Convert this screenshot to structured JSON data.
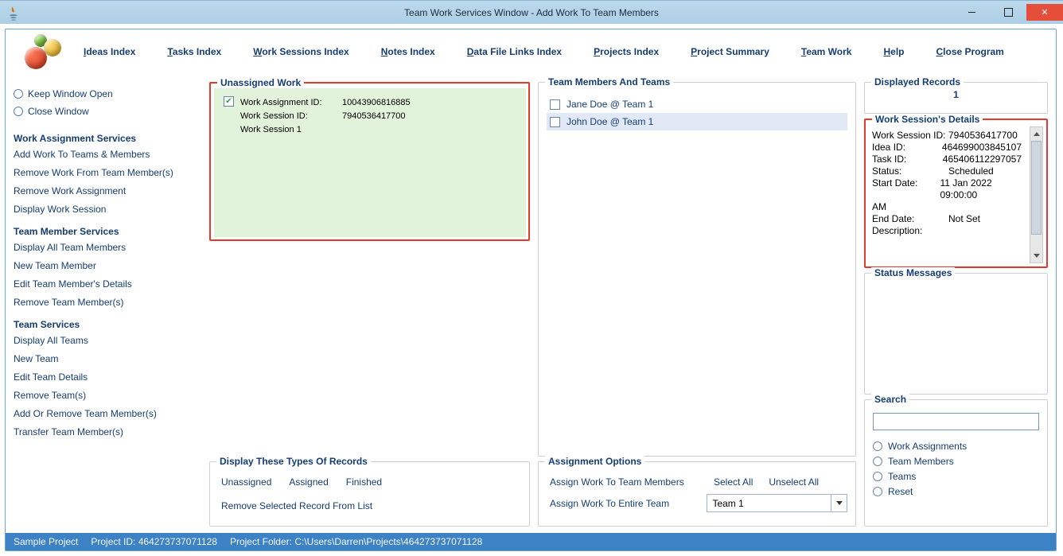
{
  "titlebar": {
    "title": "Team Work Services Window - Add Work To Team Members"
  },
  "menu": {
    "items": [
      {
        "label": "Ideas Index",
        "u": "I"
      },
      {
        "label": "Tasks Index",
        "u": "T"
      },
      {
        "label": "Work Sessions Index",
        "u": "W"
      },
      {
        "label": "Notes Index",
        "u": "N"
      },
      {
        "label": "Data File Links Index",
        "u": "D"
      },
      {
        "label": "Projects Index",
        "u": "P"
      },
      {
        "label": "Project Summary",
        "u": "P"
      },
      {
        "label": "Team Work",
        "u": "T"
      },
      {
        "label": "Help",
        "u": "H"
      },
      {
        "label": "Close Program",
        "u": "C"
      }
    ]
  },
  "sidebar": {
    "radios": {
      "keep": "Keep Window Open",
      "close": "Close Window"
    },
    "groups": [
      {
        "title": "Work Assignment Services",
        "links": [
          "Add Work To Teams & Members",
          "Remove Work From Team Member(s)",
          "Remove Work Assignment",
          "Display Work Session"
        ]
      },
      {
        "title": "Team Member Services",
        "links": [
          "Display All Team Members",
          "New Team Member",
          "Edit Team Member's Details",
          "Remove Team Member(s)"
        ]
      },
      {
        "title": "Team Services",
        "links": [
          "Display All Teams",
          "New Team",
          "Edit Team Details",
          "Remove Team(s)",
          "Add Or Remove Team Member(s)",
          "Transfer Team Member(s)"
        ]
      }
    ]
  },
  "unassigned": {
    "title": "Unassigned Work",
    "checked": true,
    "rows": [
      {
        "label": "Work Assignment ID:",
        "value": "10043906816885"
      },
      {
        "label": "Work Session ID:",
        "value": "7940536417700"
      },
      {
        "label": "Work Session 1",
        "value": ""
      }
    ]
  },
  "displayTypes": {
    "title": "Display These Types Of Records",
    "filters": [
      "Unassigned",
      "Assigned",
      "Finished"
    ],
    "remove": "Remove Selected Record From List"
  },
  "teamMembers": {
    "title": "Team Members And Teams",
    "items": [
      {
        "name": "Jane Doe @ Team 1",
        "selected": false
      },
      {
        "name": "John Doe @ Team 1",
        "selected": true
      }
    ]
  },
  "assignOpts": {
    "title": "Assignment Options",
    "assignMembers": "Assign Work To Team Members",
    "selectAll": "Select All",
    "unselectAll": "Unselect All",
    "assignTeam": "Assign Work To Entire Team",
    "teamValue": "Team 1"
  },
  "displayedRecords": {
    "title": "Displayed Records",
    "count": "1"
  },
  "sessionDetails": {
    "title": "Work Session's Details",
    "lines": [
      {
        "lab": "Work Session ID:",
        "val": "7940536417700"
      },
      {
        "lab": "Idea ID:",
        "val": "464699003845107"
      },
      {
        "lab": "Task ID:",
        "val": "465406112297057"
      },
      {
        "lab": "",
        "val": ""
      },
      {
        "lab": "Status:",
        "val": "Scheduled"
      },
      {
        "lab": "Start Date:",
        "val": "11 Jan 2022  09:00:00"
      },
      {
        "lab": "AM",
        "val": ""
      },
      {
        "lab": "End Date:",
        "val": "Not Set"
      },
      {
        "lab": "",
        "val": ""
      },
      {
        "lab": "Description:",
        "val": ""
      }
    ]
  },
  "statusMessages": {
    "title": "Status Messages"
  },
  "search": {
    "title": "Search",
    "value": "",
    "options": [
      "Work Assignments",
      "Team Members",
      "Teams",
      "Reset"
    ]
  },
  "statusbar": {
    "project": "Sample Project",
    "projectIdLabel": "Project ID:",
    "projectId": "464273737071128",
    "folderLabel": "Project Folder:",
    "folder": "C:\\Users\\Darren\\Projects\\464273737071128"
  }
}
